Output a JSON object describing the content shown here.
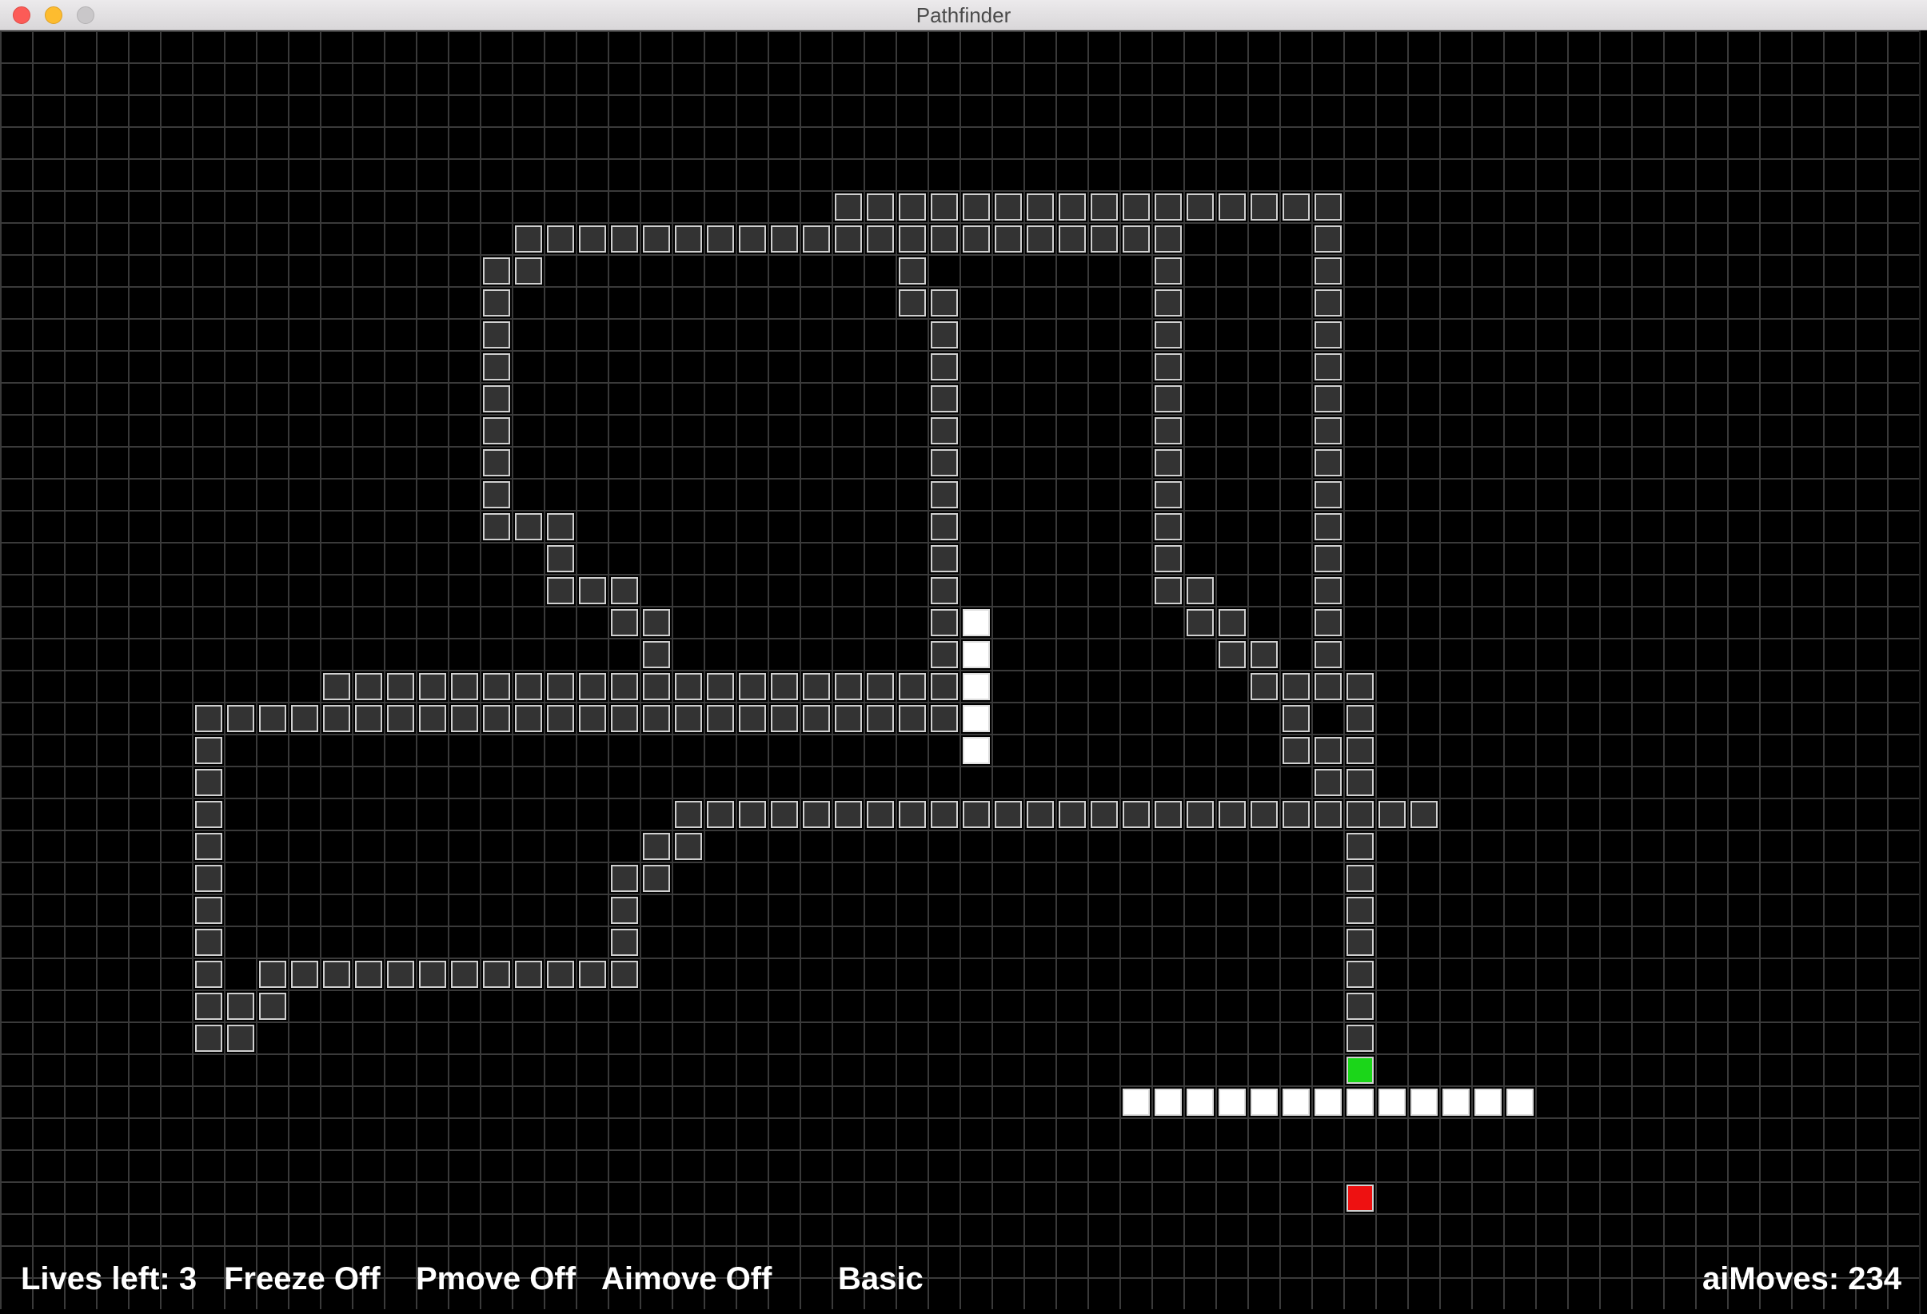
{
  "window": {
    "title": "Pathfinder"
  },
  "status": {
    "lives": "Lives left: 3",
    "freeze": "Freeze Off",
    "pmove": "Pmove Off",
    "aimove": "Aimove Off",
    "mode": "Basic",
    "ai_moves": "aiMoves: 234"
  },
  "colors": {
    "background": "#000000",
    "wall_fill": "#333333",
    "wall_border": "#d0d0d0",
    "white_block": "#ffffff",
    "player": "#1bd619",
    "target": "#ee1111"
  },
  "grid": {
    "cols": 60,
    "rows": 40,
    "wall_cells": [
      [
        26,
        5
      ],
      [
        27,
        5
      ],
      [
        28,
        5
      ],
      [
        29,
        5
      ],
      [
        30,
        5
      ],
      [
        31,
        5
      ],
      [
        32,
        5
      ],
      [
        33,
        5
      ],
      [
        34,
        5
      ],
      [
        35,
        5
      ],
      [
        36,
        5
      ],
      [
        37,
        5
      ],
      [
        38,
        5
      ],
      [
        39,
        5
      ],
      [
        40,
        5
      ],
      [
        41,
        5
      ],
      [
        16,
        6
      ],
      [
        17,
        6
      ],
      [
        18,
        6
      ],
      [
        19,
        6
      ],
      [
        20,
        6
      ],
      [
        21,
        6
      ],
      [
        22,
        6
      ],
      [
        23,
        6
      ],
      [
        24,
        6
      ],
      [
        25,
        6
      ],
      [
        26,
        6
      ],
      [
        27,
        6
      ],
      [
        28,
        6
      ],
      [
        29,
        6
      ],
      [
        30,
        6
      ],
      [
        31,
        6
      ],
      [
        32,
        6
      ],
      [
        33,
        6
      ],
      [
        34,
        6
      ],
      [
        35,
        6
      ],
      [
        36,
        6
      ],
      [
        41,
        6
      ],
      [
        15,
        7
      ],
      [
        16,
        7
      ],
      [
        28,
        7
      ],
      [
        36,
        7
      ],
      [
        41,
        7
      ],
      [
        15,
        8
      ],
      [
        28,
        8
      ],
      [
        29,
        8
      ],
      [
        36,
        8
      ],
      [
        41,
        8
      ],
      [
        15,
        9
      ],
      [
        29,
        9
      ],
      [
        36,
        9
      ],
      [
        41,
        9
      ],
      [
        15,
        10
      ],
      [
        29,
        10
      ],
      [
        36,
        10
      ],
      [
        41,
        10
      ],
      [
        15,
        11
      ],
      [
        29,
        11
      ],
      [
        36,
        11
      ],
      [
        41,
        11
      ],
      [
        15,
        12
      ],
      [
        29,
        12
      ],
      [
        36,
        12
      ],
      [
        41,
        12
      ],
      [
        15,
        13
      ],
      [
        29,
        13
      ],
      [
        36,
        13
      ],
      [
        41,
        13
      ],
      [
        15,
        14
      ],
      [
        29,
        14
      ],
      [
        36,
        14
      ],
      [
        41,
        14
      ],
      [
        15,
        15
      ],
      [
        16,
        15
      ],
      [
        17,
        15
      ],
      [
        29,
        15
      ],
      [
        36,
        15
      ],
      [
        41,
        15
      ],
      [
        17,
        16
      ],
      [
        29,
        16
      ],
      [
        36,
        16
      ],
      [
        41,
        16
      ],
      [
        17,
        17
      ],
      [
        18,
        17
      ],
      [
        19,
        17
      ],
      [
        29,
        17
      ],
      [
        36,
        17
      ],
      [
        37,
        17
      ],
      [
        41,
        17
      ],
      [
        19,
        18
      ],
      [
        20,
        18
      ],
      [
        29,
        18
      ],
      [
        37,
        18
      ],
      [
        38,
        18
      ],
      [
        41,
        18
      ],
      [
        20,
        19
      ],
      [
        29,
        19
      ],
      [
        38,
        19
      ],
      [
        39,
        19
      ],
      [
        41,
        19
      ],
      [
        10,
        20
      ],
      [
        11,
        20
      ],
      [
        12,
        20
      ],
      [
        13,
        20
      ],
      [
        14,
        20
      ],
      [
        15,
        20
      ],
      [
        16,
        20
      ],
      [
        17,
        20
      ],
      [
        18,
        20
      ],
      [
        19,
        20
      ],
      [
        20,
        20
      ],
      [
        21,
        20
      ],
      [
        22,
        20
      ],
      [
        23,
        20
      ],
      [
        24,
        20
      ],
      [
        25,
        20
      ],
      [
        26,
        20
      ],
      [
        27,
        20
      ],
      [
        28,
        20
      ],
      [
        29,
        20
      ],
      [
        39,
        20
      ],
      [
        40,
        20
      ],
      [
        41,
        20
      ],
      [
        42,
        20
      ],
      [
        6,
        21
      ],
      [
        7,
        21
      ],
      [
        8,
        21
      ],
      [
        9,
        21
      ],
      [
        10,
        21
      ],
      [
        11,
        21
      ],
      [
        12,
        21
      ],
      [
        13,
        21
      ],
      [
        14,
        21
      ],
      [
        15,
        21
      ],
      [
        16,
        21
      ],
      [
        17,
        21
      ],
      [
        18,
        21
      ],
      [
        19,
        21
      ],
      [
        20,
        21
      ],
      [
        21,
        21
      ],
      [
        22,
        21
      ],
      [
        23,
        21
      ],
      [
        24,
        21
      ],
      [
        25,
        21
      ],
      [
        26,
        21
      ],
      [
        27,
        21
      ],
      [
        28,
        21
      ],
      [
        29,
        21
      ],
      [
        40,
        21
      ],
      [
        42,
        21
      ],
      [
        6,
        22
      ],
      [
        40,
        22
      ],
      [
        41,
        22
      ],
      [
        42,
        22
      ],
      [
        6,
        23
      ],
      [
        41,
        23
      ],
      [
        42,
        23
      ],
      [
        6,
        24
      ],
      [
        21,
        24
      ],
      [
        22,
        24
      ],
      [
        23,
        24
      ],
      [
        24,
        24
      ],
      [
        25,
        24
      ],
      [
        26,
        24
      ],
      [
        27,
        24
      ],
      [
        28,
        24
      ],
      [
        29,
        24
      ],
      [
        30,
        24
      ],
      [
        31,
        24
      ],
      [
        32,
        24
      ],
      [
        33,
        24
      ],
      [
        34,
        24
      ],
      [
        35,
        24
      ],
      [
        36,
        24
      ],
      [
        37,
        24
      ],
      [
        38,
        24
      ],
      [
        39,
        24
      ],
      [
        40,
        24
      ],
      [
        41,
        24
      ],
      [
        42,
        24
      ],
      [
        43,
        24
      ],
      [
        44,
        24
      ],
      [
        6,
        25
      ],
      [
        20,
        25
      ],
      [
        21,
        25
      ],
      [
        42,
        25
      ],
      [
        6,
        26
      ],
      [
        19,
        26
      ],
      [
        20,
        26
      ],
      [
        42,
        26
      ],
      [
        6,
        27
      ],
      [
        19,
        27
      ],
      [
        42,
        27
      ],
      [
        6,
        28
      ],
      [
        19,
        28
      ],
      [
        42,
        28
      ],
      [
        6,
        29
      ],
      [
        8,
        29
      ],
      [
        9,
        29
      ],
      [
        10,
        29
      ],
      [
        11,
        29
      ],
      [
        12,
        29
      ],
      [
        13,
        29
      ],
      [
        14,
        29
      ],
      [
        15,
        29
      ],
      [
        16,
        29
      ],
      [
        17,
        29
      ],
      [
        18,
        29
      ],
      [
        19,
        29
      ],
      [
        42,
        29
      ],
      [
        6,
        30
      ],
      [
        7,
        30
      ],
      [
        8,
        30
      ],
      [
        42,
        30
      ],
      [
        6,
        31
      ],
      [
        7,
        31
      ],
      [
        42,
        31
      ]
    ],
    "white_cells": [
      [
        30,
        18
      ],
      [
        30,
        19
      ],
      [
        30,
        20
      ],
      [
        30,
        21
      ],
      [
        30,
        22
      ],
      [
        35,
        33
      ],
      [
        36,
        33
      ],
      [
        37,
        33
      ],
      [
        38,
        33
      ],
      [
        39,
        33
      ],
      [
        40,
        33
      ],
      [
        41,
        33
      ],
      [
        42,
        33
      ],
      [
        43,
        33
      ],
      [
        44,
        33
      ],
      [
        45,
        33
      ],
      [
        46,
        33
      ],
      [
        47,
        33
      ]
    ],
    "player_cell": [
      42,
      32
    ],
    "target_cell": [
      42,
      36
    ]
  }
}
